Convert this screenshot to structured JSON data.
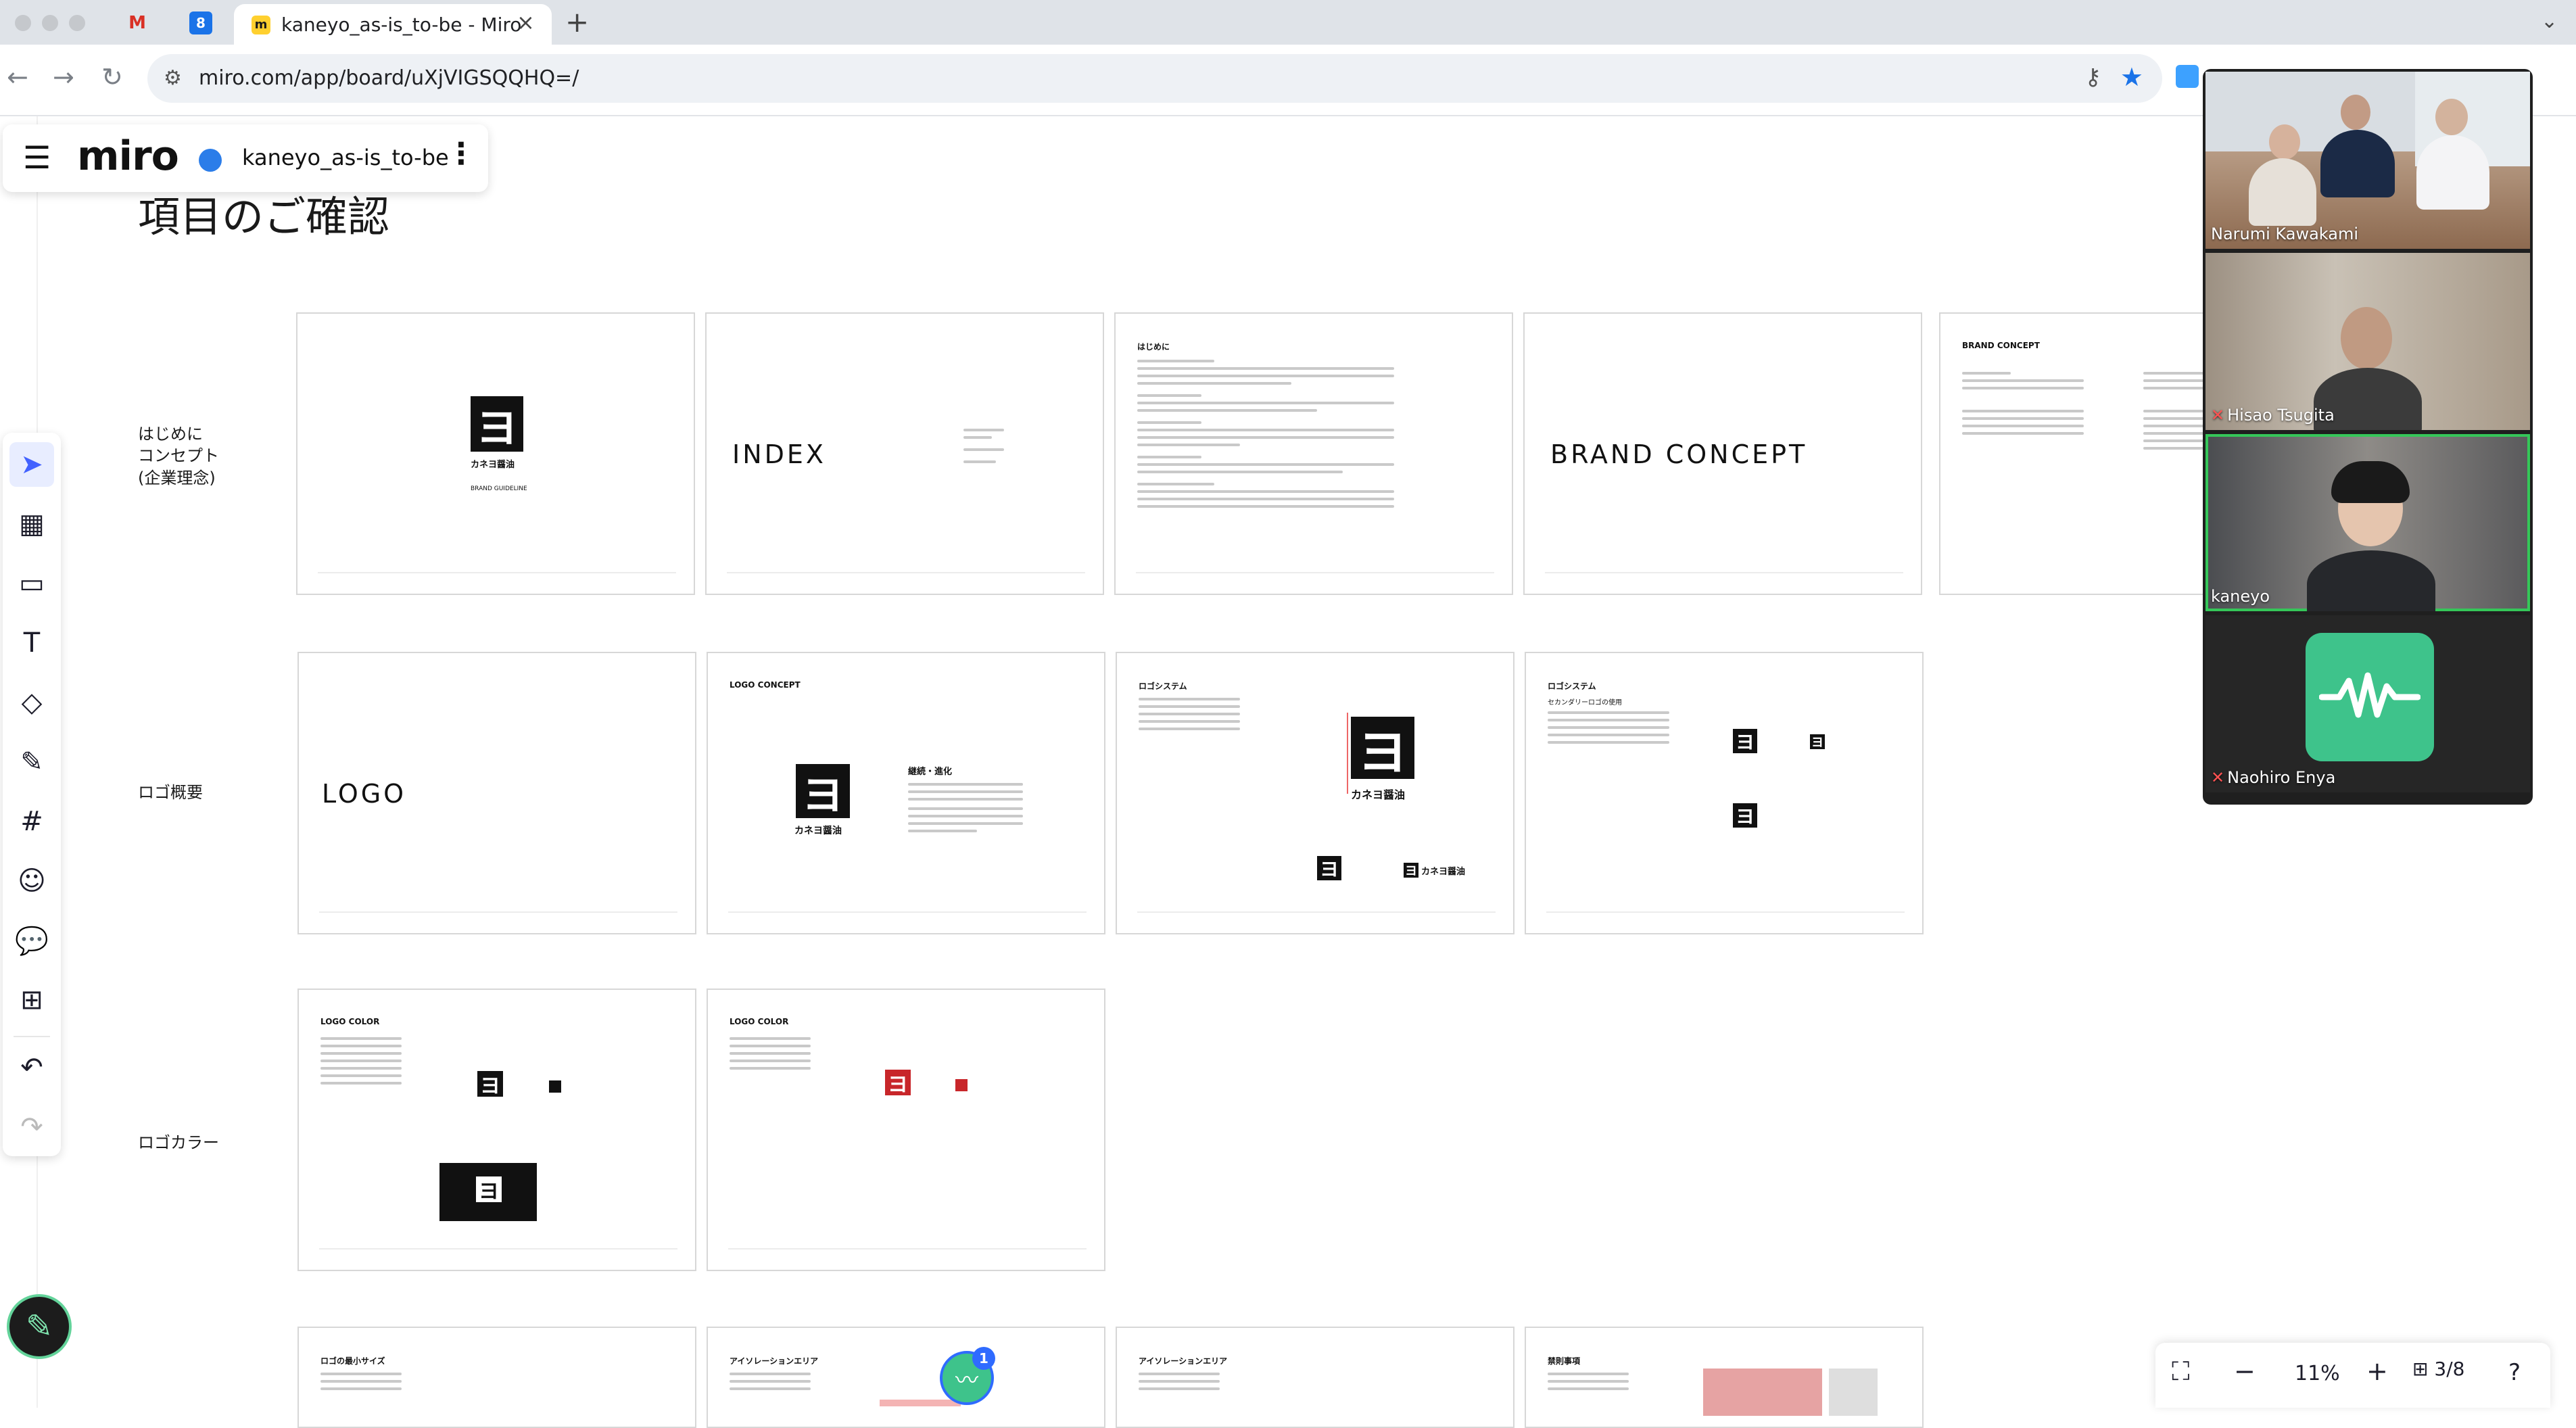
{
  "browser": {
    "active_tab_title": "kaneyo_as-is_to-be - Miro",
    "gmail_tab_icon": "gmail-icon",
    "calendar_tab_icon": "calendar-icon",
    "calendar_tab_text": "8",
    "url": "miro.com/app/board/uXjVIGSQQHQ=/"
  },
  "miro": {
    "logo": "miro",
    "board_name": "kaneyo_as-is_to-be",
    "page_heading": "項目のご確認",
    "zoom": "11%",
    "pages": "3/8",
    "ai_badge_count": "1"
  },
  "rows": [
    {
      "label": "はじめに\nコンセプト\n(企業理念)"
    },
    {
      "label": "ロゴ概要"
    },
    {
      "label": "ロゴカラー"
    }
  ],
  "frames": {
    "cover_brand": {
      "logo_text": "カネヨ醤油",
      "caption": "BRAND GUIDELINE"
    },
    "index": {
      "title": "INDEX"
    },
    "intro": {
      "title": "はじめに"
    },
    "brand_concept": {
      "title": "BRAND CONCEPT"
    },
    "brand_concept_detail": {
      "title": "BRAND CONCEPT"
    },
    "logo": {
      "title": "LOGO"
    },
    "logo_concept": {
      "title": "LOGO CONCEPT",
      "subtitle": "継続・進化",
      "logo_text": "カネヨ醤油"
    },
    "logo_system_1": {
      "title": "ロゴシステム",
      "logo_text": "カネヨ醤油"
    },
    "logo_system_2": {
      "title": "ロゴシステム",
      "subtitle": "セカンダリーロゴの使用"
    },
    "logo_color_1": {
      "title": "LOGO COLOR"
    },
    "logo_color_2": {
      "title": "LOGO COLOR"
    },
    "min_size": {
      "title": "ロゴの最小サイズ"
    },
    "isolation_1": {
      "title": "アイソレーションエリア"
    },
    "isolation_2": {
      "title": "アイソレーションエリア"
    },
    "prohibited": {
      "title": "禁則事項"
    }
  },
  "video": {
    "participants": [
      {
        "name": "Narumi Kawakami",
        "muted": false
      },
      {
        "name": "Hisao Tsugita",
        "muted": true
      },
      {
        "name": "kaneyo",
        "muted": false,
        "speaking": true
      },
      {
        "name": "Naohiro Enya",
        "muted": true,
        "avatar_icon": "audio-wave-icon"
      }
    ]
  },
  "colors": {
    "miro_accent": "#4262ff",
    "brand_red": "#c8262a",
    "speaking_green": "#35c759",
    "avatar_green": "#3ec38b"
  }
}
